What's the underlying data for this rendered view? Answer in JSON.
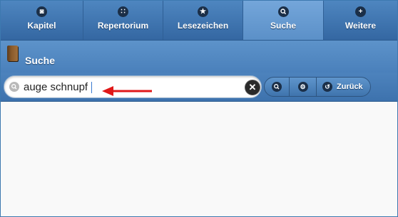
{
  "tabs": [
    {
      "label": "Kapitel",
      "icon": "binoculars-icon",
      "glyph": "◙"
    },
    {
      "label": "Repertorium",
      "icon": "grid-icon",
      "glyph": "∷"
    },
    {
      "label": "Lesezeichen",
      "icon": "star-icon",
      "glyph": "★"
    },
    {
      "label": "Suche",
      "icon": "search-icon",
      "glyph": "⚲"
    },
    {
      "label": "Weitere",
      "icon": "plus-icon",
      "glyph": "+"
    }
  ],
  "active_tab": "Suche",
  "page": {
    "title": "Suche"
  },
  "search": {
    "value": "auge schnupf",
    "placeholder": ""
  },
  "buttons": {
    "back_label": "Zurück"
  },
  "colors": {
    "header": "#4a80bb",
    "active_tab": "#6a9ed4",
    "arrow": "#e01818"
  }
}
